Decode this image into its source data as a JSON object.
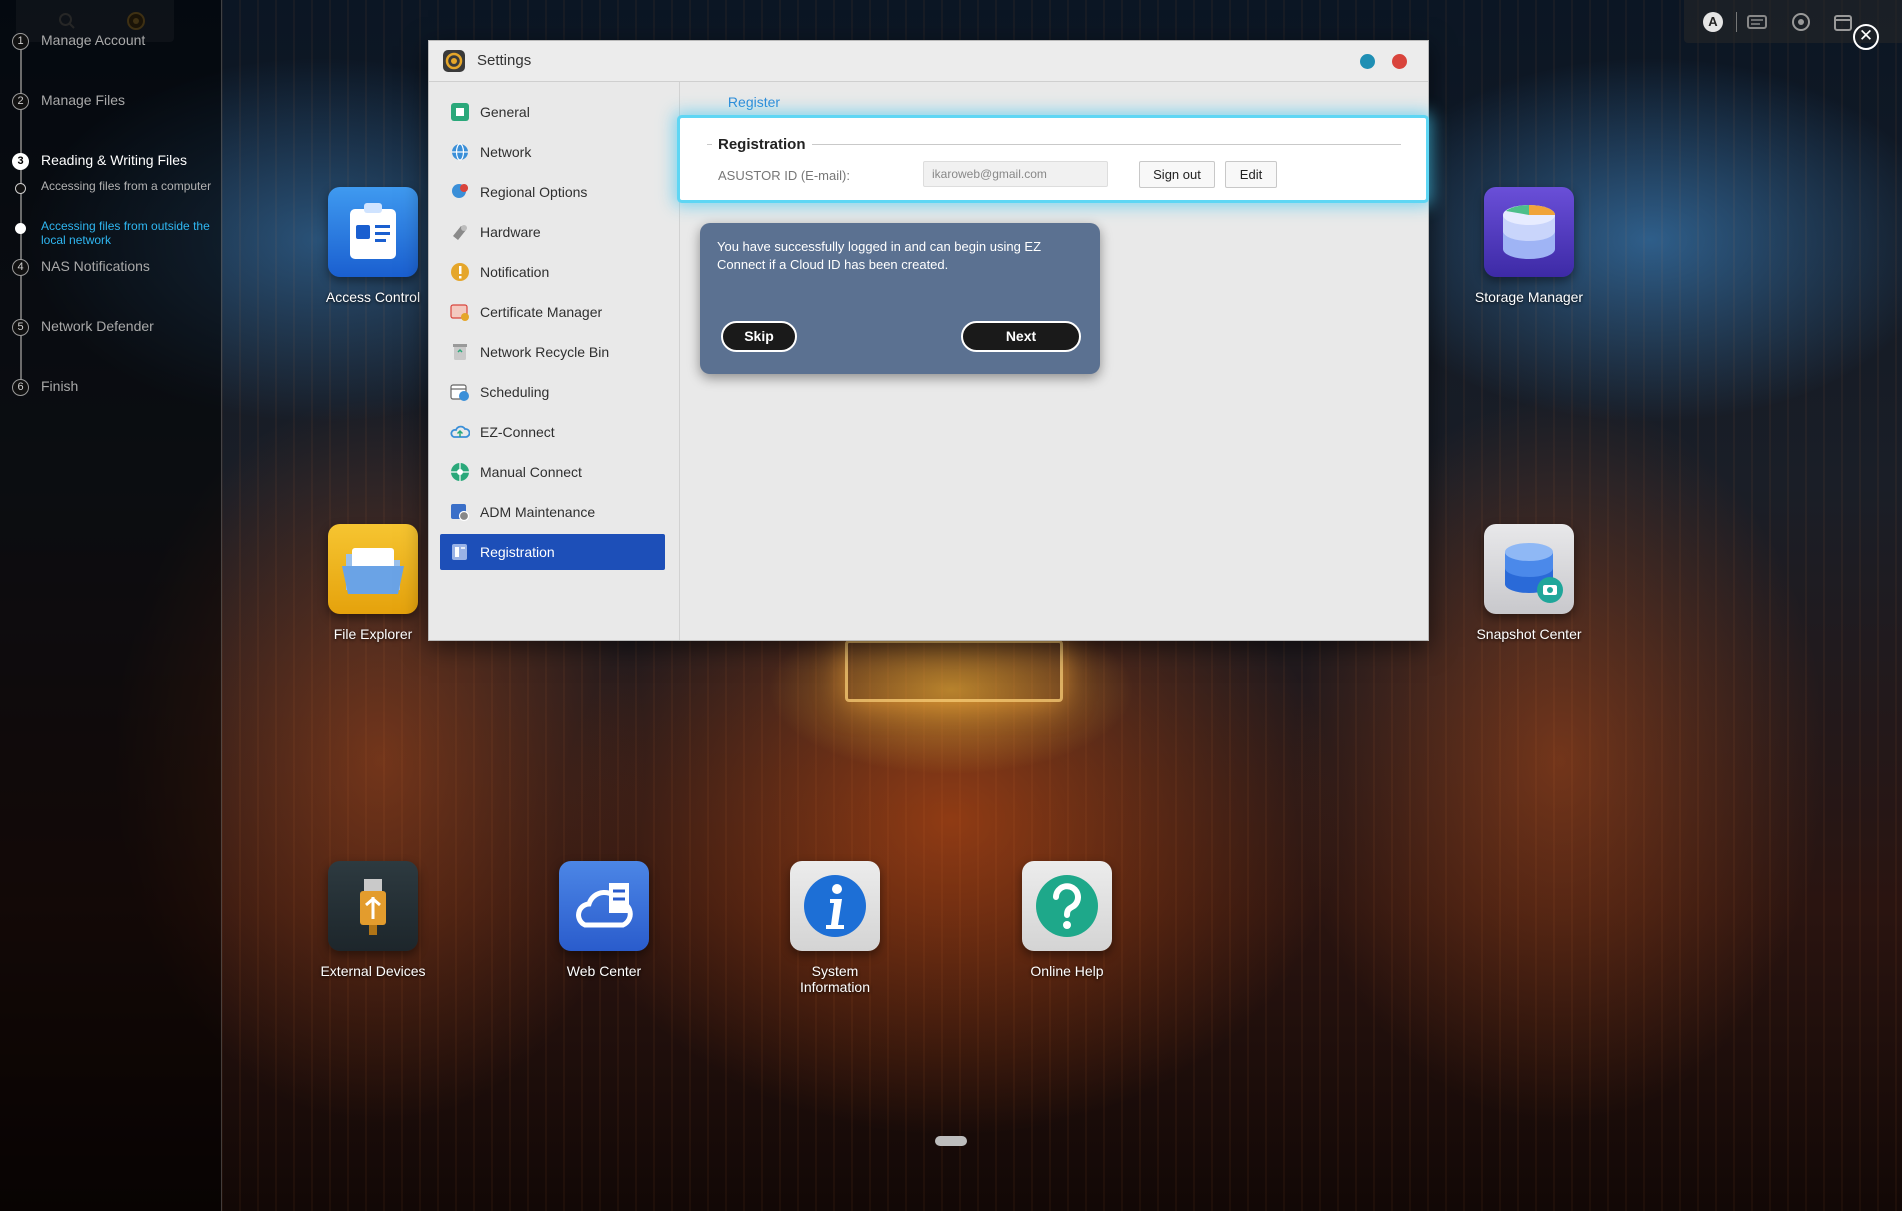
{
  "tutorial": {
    "steps": [
      {
        "num": "1",
        "label": "Manage Account"
      },
      {
        "num": "2",
        "label": "Manage Files"
      },
      {
        "num": "3",
        "label": "Reading & Writing Files"
      },
      {
        "num": "4",
        "label": "NAS Notifications"
      },
      {
        "num": "5",
        "label": "Network Defender"
      },
      {
        "num": "6",
        "label": "Finish"
      }
    ],
    "substeps": [
      {
        "label": "Accessing files from a computer"
      },
      {
        "label": "Accessing files from outside the local network"
      }
    ],
    "close_glyph": "✕"
  },
  "taskbar": {
    "account_glyph": "A"
  },
  "desktop": {
    "icons": [
      {
        "label": "Access Control"
      },
      {
        "label": "Storage Manager"
      },
      {
        "label": "File Explorer"
      },
      {
        "label": "Snapshot Center"
      },
      {
        "label": "External Devices"
      },
      {
        "label": "Web Center"
      },
      {
        "label": "System Information"
      },
      {
        "label": "Online Help"
      }
    ]
  },
  "settings": {
    "title": "Settings",
    "nav": [
      {
        "label": "General"
      },
      {
        "label": "Network"
      },
      {
        "label": "Regional Options"
      },
      {
        "label": "Hardware"
      },
      {
        "label": "Notification"
      },
      {
        "label": "Certificate Manager"
      },
      {
        "label": "Network Recycle Bin"
      },
      {
        "label": "Scheduling"
      },
      {
        "label": "EZ-Connect"
      },
      {
        "label": "Manual Connect"
      },
      {
        "label": "ADM Maintenance"
      },
      {
        "label": "Registration"
      }
    ],
    "tab": "Register",
    "registration": {
      "legend": "Registration",
      "field_label": "ASUSTOR ID (E-mail):",
      "field_value": "ikaroweb@gmail.com",
      "sign_out": "Sign out",
      "edit": "Edit"
    },
    "popover": {
      "message": "You have successfully logged in and can begin using EZ Connect if a Cloud ID has been created.",
      "skip": "Skip",
      "next": "Next"
    }
  },
  "colors": {
    "accent": "#2a8ad8",
    "selected_nav": "#1d4fb8",
    "highlight": "#5ed6f4",
    "popover_bg": "#5b7191",
    "tutorial_current": "#2fb6f0",
    "minimize_btn": "#1f8fb4",
    "close_btn": "#d9443c"
  }
}
